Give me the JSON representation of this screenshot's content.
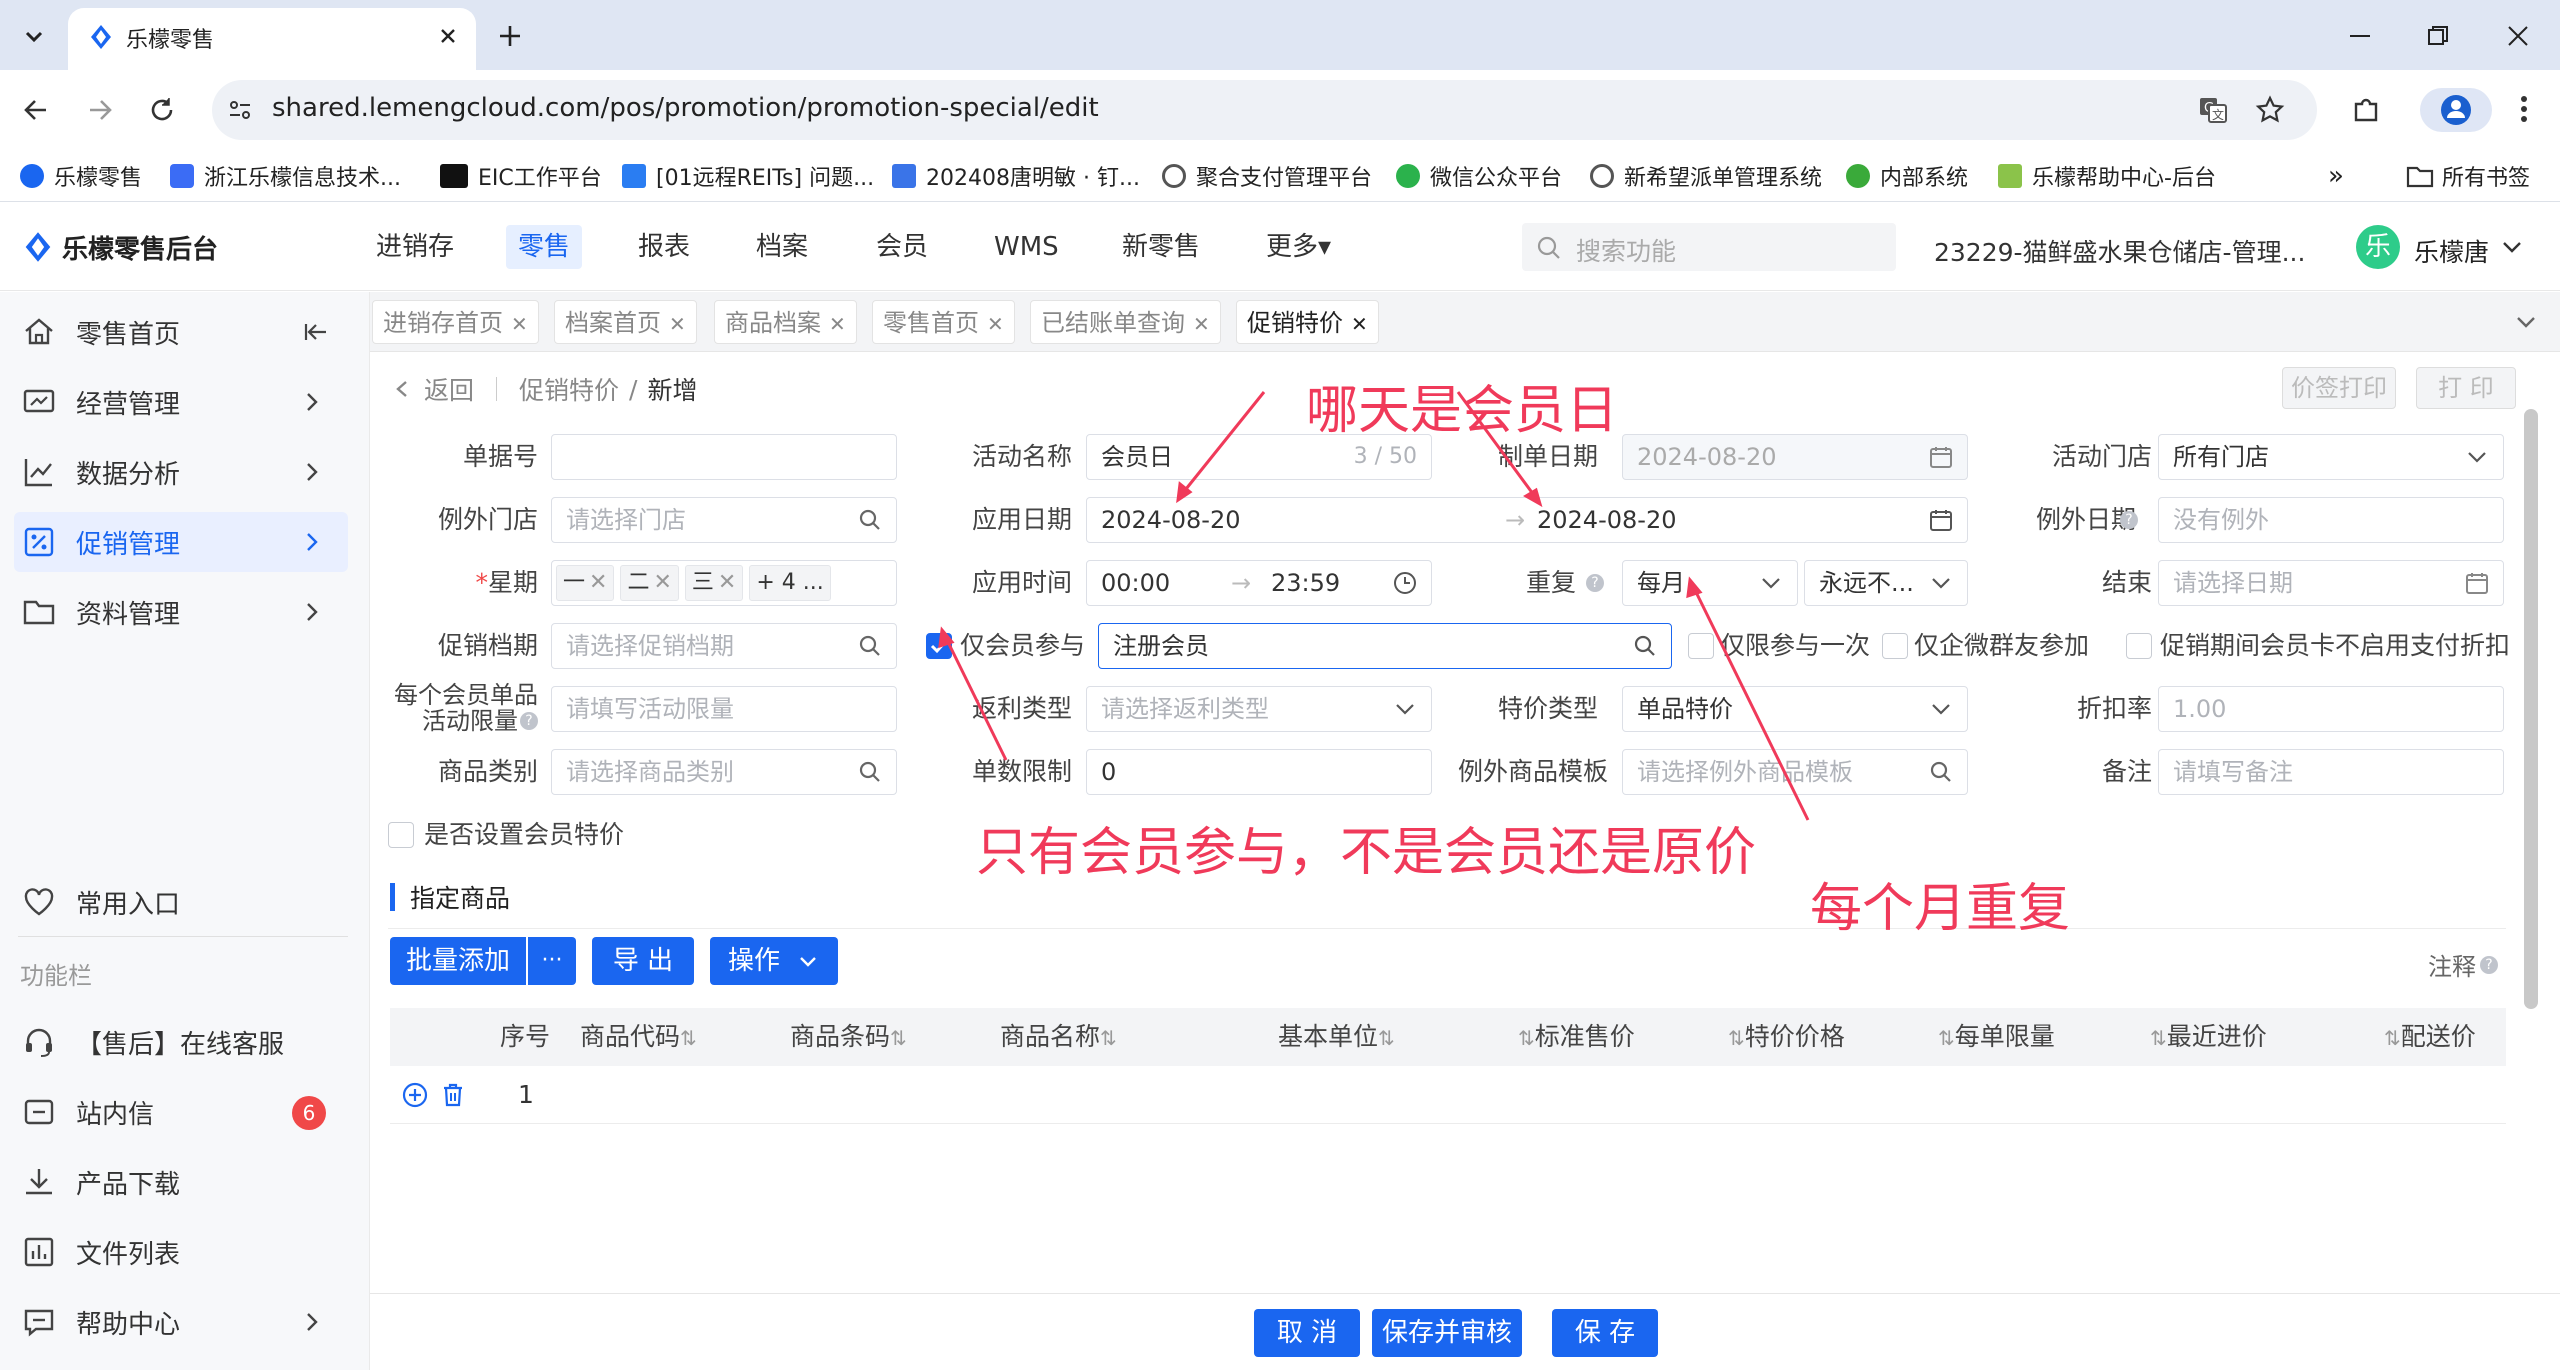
{
  "browser": {
    "tab_title": "乐檬零售",
    "url": "shared.lemengcloud.com/pos/promotion/promotion-special/edit",
    "bookmarks": [
      "乐檬零售",
      "浙江乐檬信息技术...",
      "EIC工作平台",
      "[01远程REITs] 问题...",
      "202408唐明敏 · 钉...",
      "聚合支付管理平台",
      "微信公众平台",
      "新希望派单管理系统",
      "内部系统",
      "乐檬帮助中心-后台"
    ],
    "all_bookmarks": "所有书签",
    "more_bookmarks": "»"
  },
  "app": {
    "logo": "乐檬零售后台",
    "nav": [
      "进销存",
      "零售",
      "报表",
      "档案",
      "会员",
      "WMS",
      "新零售",
      "更多▾"
    ],
    "search_placeholder": "搜索功能",
    "store": "23229-猫鲜盛水果仓储店-管理...",
    "avatar_char": "乐",
    "user": "乐檬唐"
  },
  "sidebar": {
    "items": [
      "零售首页",
      "经营管理",
      "数据分析",
      "促销管理",
      "资料管理"
    ],
    "section_title": "常用入口",
    "section2_title": "功能栏",
    "func_items": [
      "【售后】在线客服",
      "站内信",
      "产品下载",
      "文件列表",
      "帮助中心"
    ],
    "badge": "6"
  },
  "page_tabs": [
    "进销存首页",
    "档案首页",
    "商品档案",
    "零售首页",
    "已结账单查询",
    "促销特价"
  ],
  "breadcrumb": {
    "back": "返回",
    "parent": "促销特价",
    "sep": "/",
    "current": "新增"
  },
  "top_buttons": {
    "price_print": "价签打印",
    "print": "打 印"
  },
  "form": {
    "bill_no_label": "单据号",
    "activity_name_label": "活动名称",
    "activity_name": "会员日",
    "activity_name_count": "3 / 50",
    "make_date_label": "制单日期",
    "make_date": "2024-08-20",
    "store_label": "活动门店",
    "store": "所有门店",
    "except_store_label": "例外门店",
    "except_store_ph": "请选择门店",
    "apply_date_label": "应用日期",
    "apply_date_start": "2024-08-20",
    "apply_date_end": "2024-08-20",
    "except_date_label": "例外日期",
    "except_date_ph": "没有例外",
    "weekday_label": "星期",
    "weekday_tags": [
      "一",
      "二",
      "三"
    ],
    "weekday_more": "+ 4 ...",
    "apply_time_label": "应用时间",
    "apply_time_start": "00:00",
    "apply_time_end": "23:59",
    "repeat_label": "重复",
    "repeat": "每月",
    "repeat_end": "永远不...",
    "end_label": "结束",
    "end_ph": "请选择日期",
    "promo_period_label": "促销档期",
    "promo_period_ph": "请选择促销档期",
    "member_only_label": "仅会员参与",
    "member_type": "注册会员",
    "once_label": "仅限参与一次",
    "wechat_label": "仅企微群友参加",
    "card_label": "促销期间会员卡不启用支付折扣",
    "limit_label_1": "每个会员单品",
    "limit_label_2": "活动限量",
    "limit_ph": "请填写活动限量",
    "rebate_label": "返利类型",
    "rebate_ph": "请选择返利类型",
    "special_type_label": "特价类型",
    "special_type": "单品特价",
    "discount_label": "折扣率",
    "discount": "1.00",
    "category_label": "商品类别",
    "category_ph": "请选择商品类别",
    "count_limit_label": "单数限制",
    "count_limit": "0",
    "except_tpl_label": "例外商品模板",
    "except_tpl_ph": "请选择例外商品模板",
    "remark_label": "备注",
    "remark_ph": "请填写备注",
    "member_price_label": "是否设置会员特价"
  },
  "goods": {
    "section_title": "指定商品",
    "batch_add": "批量添加",
    "more": "···",
    "export": "导 出",
    "operate": "操作",
    "note": "注释",
    "columns": [
      "序号",
      "商品代码",
      "商品条码",
      "商品名称",
      "基本单位",
      "标准售价",
      "特价价格",
      "每单限量",
      "最近进价",
      "配送价"
    ],
    "row_no": "1"
  },
  "footer": {
    "cancel": "取 消",
    "save_review": "保存并审核",
    "save": "保 存"
  },
  "annotations": {
    "a1": "哪天是会员日",
    "a2": "只有会员参与，不是会员还是原价",
    "a3": "每个月重复"
  },
  "colors": {
    "primary": "#1a66f0",
    "annotation": "#f03a5a",
    "badge": "#f04848"
  }
}
